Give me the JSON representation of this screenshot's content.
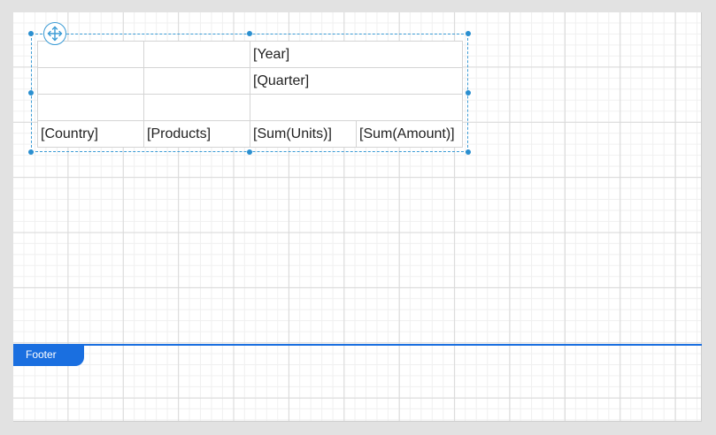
{
  "pivot": {
    "rows": [
      [
        "",
        "",
        "[Year]",
        ""
      ],
      [
        "",
        "",
        "[Quarter]",
        ""
      ],
      [
        "",
        "",
        "",
        ""
      ],
      [
        "[Country]",
        "[Products]",
        "[Sum(Units)]",
        "[Sum(Amount)]"
      ]
    ]
  },
  "footer": {
    "label": "Footer"
  },
  "colors": {
    "accent": "#1a6fe0",
    "selection": "#3a9bd5"
  },
  "icons": {
    "move": "move-arrows-icon"
  }
}
